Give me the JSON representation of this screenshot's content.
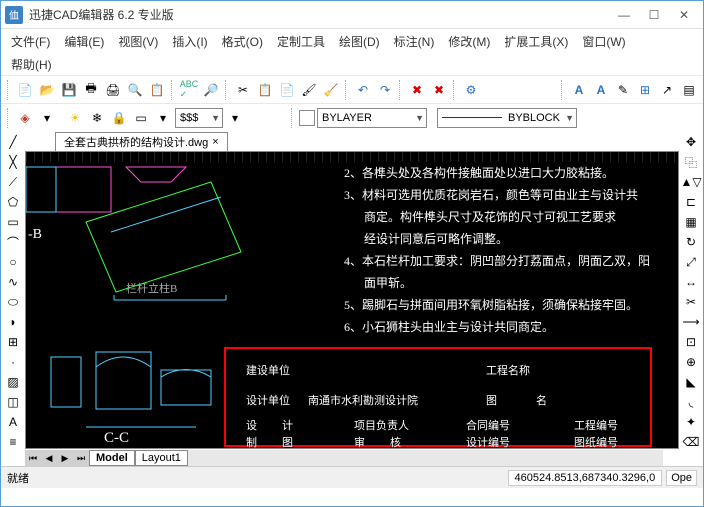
{
  "window": {
    "title": "迅捷CAD编辑器 6.2 专业版"
  },
  "menu": {
    "file": "文件(F)",
    "edit": "编辑(E)",
    "view": "视图(V)",
    "insert": "插入(I)",
    "format": "格式(O)",
    "custom_tools": "定制工具",
    "draw": "绘图(D)",
    "annotate": "标注(N)",
    "modify": "修改(M)",
    "ext_tools": "扩展工具(X)",
    "window": "窗口(W)",
    "help": "帮助(H)"
  },
  "combos": {
    "sss": "$$$",
    "bylayer": "BYLAYER",
    "byblock": "BYBLOCK"
  },
  "tab": {
    "filename": "全套古典拱桥的结构设计.dwg",
    "close": "×"
  },
  "layout": {
    "model": "Model",
    "layout1": "Layout1"
  },
  "drawing": {
    "label_b": "-B",
    "label_cc": "C-C",
    "label_post": "栏杆立柱B",
    "notes": {
      "n2": "2、各榫头处及各构件接触面处以进口大力胶粘接。",
      "n3a": "3、材料可选用优质花岗岩石，颜色等可由业主与设计共",
      "n3b": "商定。构件榫头尺寸及花饰的尺寸可视工艺要求",
      "n3c": "经设计同意后可略作调整。",
      "n4a": "4、本石栏杆加工要求：阴凹部分打荔面点，阴面乙双，阳",
      "n4b": "面甲斩。",
      "n5": "5、踢脚石与拼面间用环氧树脂粘接，须确保粘接牢固。",
      "n6": "6、小石狮柱头由业主与设计共同商定。"
    },
    "titleblock": {
      "c1": "建设单位",
      "c2": "工程名称",
      "c3": "设计单位",
      "c4": "南通市水利勘测设计院",
      "c5": "图",
      "c6": "名",
      "c7": "设",
      "c8": "计",
      "c9": "项目负责人",
      "c10": "合同编号",
      "c11": "工程编号",
      "c12": "制",
      "c13": "图",
      "c14": "审",
      "c15": "核",
      "c16": "设计编号",
      "c17": "图纸编号"
    }
  },
  "status": {
    "ready": "就绪",
    "coords": "460524.8513,687340.3296,0",
    "opt": "Ope"
  }
}
